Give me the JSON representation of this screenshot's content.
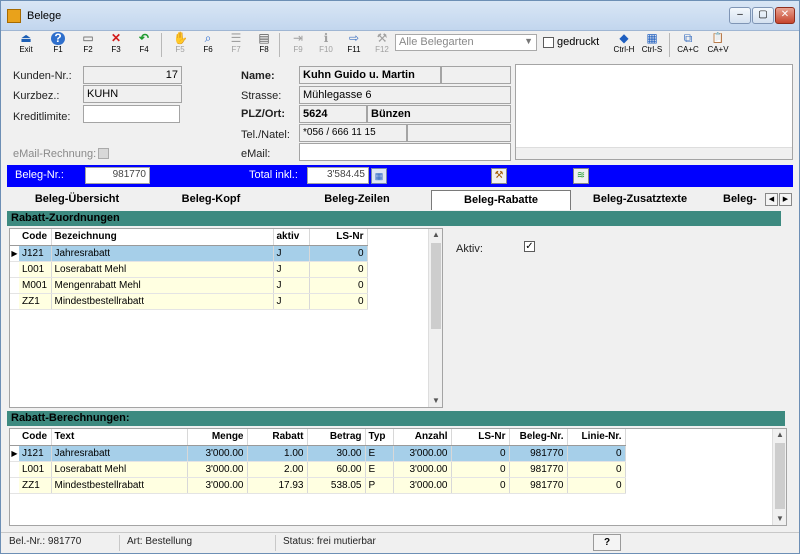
{
  "window": {
    "title": "Belege"
  },
  "titlebar": {
    "min": "‒",
    "max": "▢",
    "close": "✕"
  },
  "toolbar": {
    "buttons": [
      {
        "label": "Exit",
        "icon": "exit-icon",
        "glyph": "⏏"
      },
      {
        "label": "F1",
        "icon": "help-icon",
        "glyph": "?"
      },
      {
        "label": "F2",
        "icon": "new-document-icon",
        "glyph": "▭"
      },
      {
        "label": "F3",
        "icon": "delete-icon",
        "glyph": "✕"
      },
      {
        "label": "F4",
        "icon": "undo-arrow-icon",
        "glyph": "↶"
      },
      {
        "label": "F5",
        "icon": "hand-icon",
        "glyph": "✋"
      },
      {
        "label": "F6",
        "icon": "search-icon",
        "glyph": "⌕"
      },
      {
        "label": "F7",
        "icon": "list-icon",
        "glyph": "☰"
      },
      {
        "label": "F8",
        "icon": "print-icon",
        "glyph": "▤"
      },
      {
        "label": "F9",
        "icon": "import-icon",
        "glyph": "⇥"
      },
      {
        "label": "F10",
        "icon": "info-icon",
        "glyph": "ℹ"
      },
      {
        "label": "F11",
        "icon": "forward-icon",
        "glyph": "⇨"
      },
      {
        "label": "F12",
        "icon": "tools-icon",
        "glyph": "⚒"
      },
      {
        "label": "Ctrl-H",
        "icon": "navigate-icon",
        "glyph": "◆"
      },
      {
        "label": "Ctrl-S",
        "icon": "grid-icon",
        "glyph": "▦"
      },
      {
        "label": "CA+C",
        "icon": "copy-icon",
        "glyph": "⧉"
      },
      {
        "label": "CA+V",
        "icon": "paste-icon",
        "glyph": "📋"
      }
    ],
    "combo_value": "Alle Belegarten",
    "gedruckt_label": "gedruckt"
  },
  "customer": {
    "kunden_nr_label": "Kunden-Nr.:",
    "kunden_nr": "17",
    "kurzbez_label": "Kurzbez.:",
    "kurzbez": "KUHN",
    "kreditlimite_label": "Kreditlimite:",
    "kreditlimite": "",
    "email_rechnung_label": "eMail-Rechnung:"
  },
  "address": {
    "name_label": "Name:",
    "name": "Kuhn Guido u. Martin",
    "strasse_label": "Strasse:",
    "strasse": "Mühlegasse 6",
    "plz_label": "PLZ/Ort:",
    "plz": "5624",
    "ort": "Bünzen",
    "tel_label": "Tel./Natel:",
    "tel": "*056 / 666 11 15",
    "natel": "",
    "email_label": "eMail:",
    "email": ""
  },
  "beleg": {
    "nr_label": "Beleg-Nr.:",
    "nr": "981770",
    "total_label": "Total inkl.:",
    "total": "3'584.45"
  },
  "tabs": [
    "Beleg-Übersicht",
    "Beleg-Kopf",
    "Beleg-Zeilen",
    "Beleg-Rabatte",
    "Beleg-Zusatztexte",
    "Beleg-"
  ],
  "zuordnungen": {
    "title": "Rabatt-Zuordnungen",
    "headers": [
      "Code",
      "Bezeichnung",
      "aktiv",
      "LS-Nr"
    ],
    "rows": [
      [
        "J121",
        "Jahresrabatt",
        "J",
        "0"
      ],
      [
        "L001",
        "Loserabatt Mehl",
        "J",
        "0"
      ],
      [
        "M001",
        "Mengenrabatt Mehl",
        "J",
        "0"
      ],
      [
        "ZZ1",
        "Mindestbestellrabatt",
        "J",
        "0"
      ]
    ],
    "aktiv_label": "Aktiv:"
  },
  "berechnungen": {
    "title": "Rabatt-Berechnungen:",
    "headers": [
      "Code",
      "Text",
      "Menge",
      "Rabatt",
      "Betrag",
      "Typ",
      "Anzahl",
      "LS-Nr",
      "Beleg-Nr.",
      "Linie-Nr."
    ],
    "rows": [
      [
        "J121",
        "Jahresrabatt",
        "3'000.00",
        "1.00",
        "30.00",
        "E",
        "3'000.00",
        "0",
        "981770",
        "0"
      ],
      [
        "L001",
        "Loserabatt Mehl",
        "3'000.00",
        "2.00",
        "60.00",
        "E",
        "3'000.00",
        "0",
        "981770",
        "0"
      ],
      [
        "ZZ1",
        "Mindestbestellrabatt",
        "3'000.00",
        "17.93",
        "538.05",
        "P",
        "3'000.00",
        "0",
        "981770",
        "0"
      ]
    ]
  },
  "status": {
    "bel_nr": "Bel.-Nr.: 981770",
    "art": "Art: Bestellung",
    "status": "Status: frei mutierbar",
    "help": "?"
  }
}
